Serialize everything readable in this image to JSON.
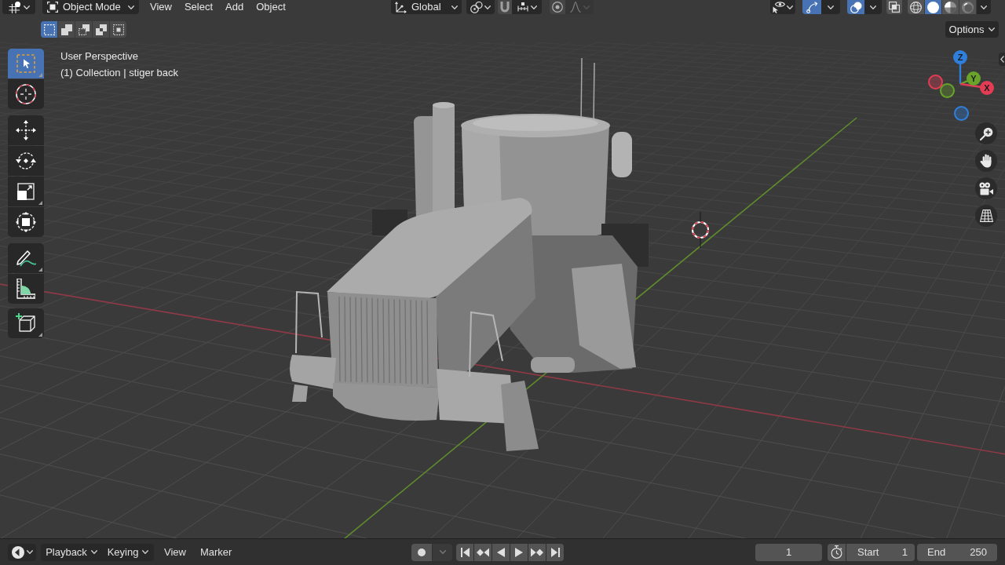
{
  "header": {
    "mode": "Object Mode",
    "menus": [
      "View",
      "Select",
      "Add",
      "Object"
    ],
    "orientation": "Global",
    "snap": {
      "on": false
    },
    "proportional_editing": {
      "on": false
    },
    "visibility": {
      "on": false
    },
    "gizmos": {
      "on": true
    },
    "overlays": {
      "on": true
    },
    "xray": {
      "on": false
    },
    "shading_modes": [
      {
        "selected": false
      },
      {
        "selected": true
      },
      {
        "selected": false
      },
      {
        "selected": false
      }
    ]
  },
  "select_modes": [
    {
      "selected": true
    },
    {
      "selected": false
    },
    {
      "selected": false
    },
    {
      "selected": false
    },
    {
      "selected": false
    }
  ],
  "options": "Options",
  "viewport": {
    "view_name": "User Perspective",
    "object_info": "(1) Collection | stiger back"
  },
  "tool_groups": [
    [
      {
        "selected": true
      },
      {
        "selected": false
      }
    ],
    [
      {
        "selected": false
      },
      {
        "selected": false
      },
      {
        "selected": false
      },
      {
        "selected": false
      }
    ],
    [
      {
        "selected": false
      },
      {
        "selected": false
      }
    ],
    [
      {
        "selected": false
      }
    ]
  ],
  "gizmo": {
    "axes": [
      {
        "label": "Z",
        "color": "#2f7fdc"
      },
      {
        "label": "Y",
        "color": "#6aa329"
      },
      {
        "label": "X",
        "color": "#e33d55"
      }
    ]
  },
  "timeline": {
    "dropdowns": [
      "Playback",
      "Keying"
    ],
    "menus": [
      "View",
      "Marker"
    ],
    "auto_keying": {
      "on": false
    },
    "current_frame": "1",
    "start_label": "Start",
    "start": "1",
    "end_label": "End",
    "end": "250"
  }
}
